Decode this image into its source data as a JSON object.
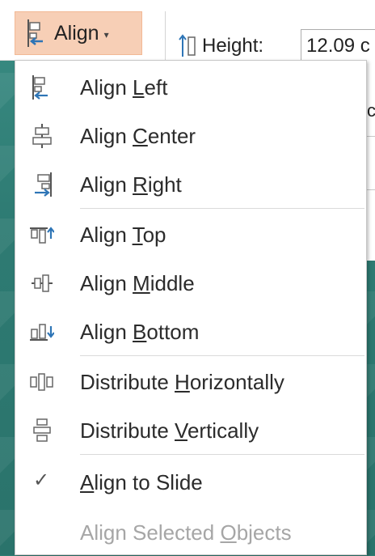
{
  "ribbon": {
    "align_button": {
      "label": "Align",
      "caret": "▾"
    },
    "height": {
      "label": "Height:",
      "value": "12.09 c"
    }
  },
  "behind": {
    "right_fragment": "c"
  },
  "menu": {
    "items": [
      {
        "id": "align-left",
        "pre": "Align ",
        "u": "L",
        "post": "eft",
        "icon": "align-left-icon"
      },
      {
        "id": "align-center",
        "pre": "Align ",
        "u": "C",
        "post": "enter",
        "icon": "align-center-icon"
      },
      {
        "id": "align-right",
        "pre": "Align ",
        "u": "R",
        "post": "ight",
        "icon": "align-right-icon"
      },
      {
        "id": "align-top",
        "pre": "Align ",
        "u": "T",
        "post": "op",
        "icon": "align-top-icon"
      },
      {
        "id": "align-middle",
        "pre": "Align ",
        "u": "M",
        "post": "iddle",
        "icon": "align-middle-icon"
      },
      {
        "id": "align-bottom",
        "pre": "Align ",
        "u": "B",
        "post": "ottom",
        "icon": "align-bottom-icon"
      },
      {
        "id": "distribute-horizontally",
        "pre": "Distribute ",
        "u": "H",
        "post": "orizontally",
        "icon": "distribute-horizontally-icon"
      },
      {
        "id": "distribute-vertically",
        "pre": "Distribute ",
        "u": "V",
        "post": "ertically",
        "icon": "distribute-vertically-icon"
      },
      {
        "id": "align-to-slide",
        "pre": "",
        "u": "A",
        "post": "lign to Slide",
        "icon": "checkmark-icon",
        "checked": true
      },
      {
        "id": "align-selected-objects",
        "pre": "Align Selected ",
        "u": "O",
        "post": "bjects",
        "disabled": true
      }
    ]
  },
  "colors": {
    "accent_blue": "#2e75b6",
    "highlight": "#f7cfb6",
    "disabled": "#a6a6a6"
  }
}
